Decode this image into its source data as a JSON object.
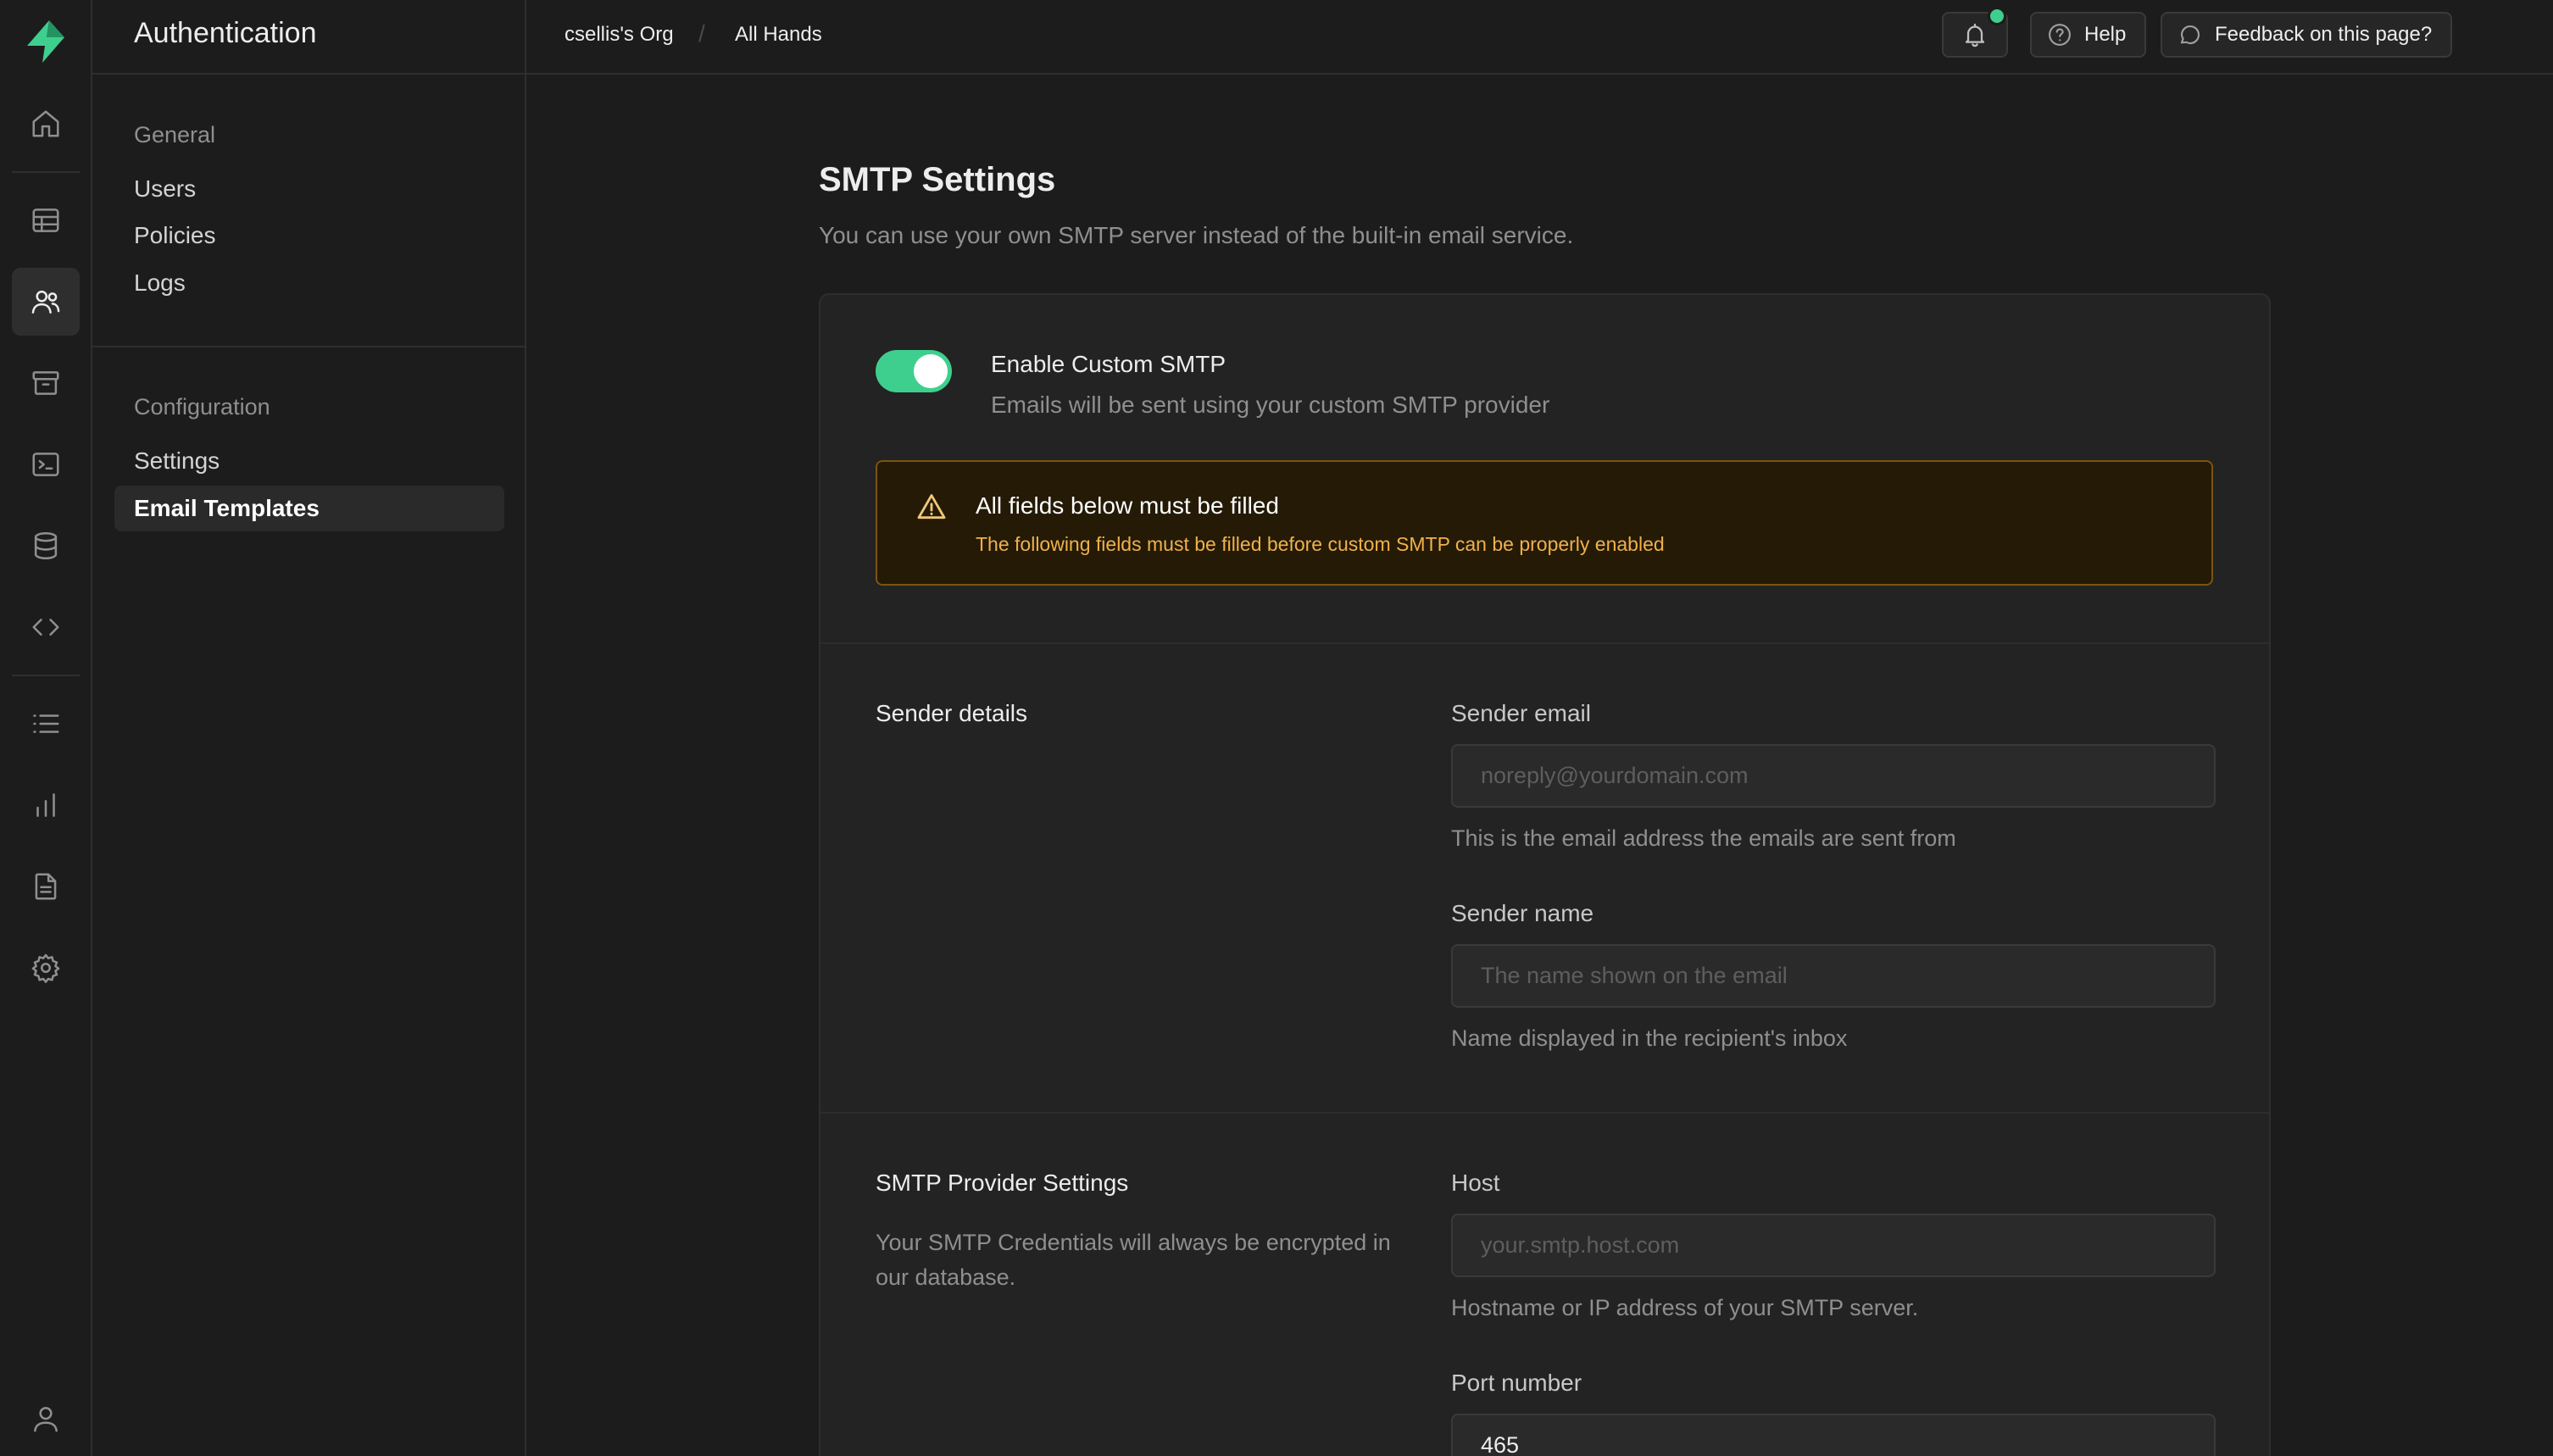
{
  "app": {
    "section_title": "Authentication",
    "accent_color": "#3ecf8e"
  },
  "rail": {
    "items": [
      {
        "icon": "home-icon"
      },
      {
        "icon": "table-editor-icon"
      },
      {
        "icon": "users-icon",
        "active": true
      },
      {
        "icon": "storage-icon"
      },
      {
        "icon": "sql-editor-icon"
      },
      {
        "icon": "database-icon"
      },
      {
        "icon": "api-code-icon"
      },
      {
        "icon": "logs-list-icon"
      },
      {
        "icon": "reports-chart-icon"
      },
      {
        "icon": "docs-icon"
      },
      {
        "icon": "settings-gear-icon"
      },
      {
        "icon": "account-user-icon"
      }
    ]
  },
  "sidebar": {
    "groups": [
      {
        "title": "General",
        "items": [
          "Users",
          "Policies",
          "Logs"
        ]
      },
      {
        "title": "Configuration",
        "items": [
          "Settings",
          "Email Templates"
        ],
        "active": "Email Templates"
      }
    ]
  },
  "topbar": {
    "org": "csellis's Org",
    "project": "All Hands",
    "help_label": "Help",
    "feedback_label": "Feedback on this page?"
  },
  "page": {
    "title": "SMTP Settings",
    "subtitle": "You can use your own SMTP server instead of the built-in email service."
  },
  "smtp": {
    "toggle_label": "Enable Custom SMTP",
    "toggle_desc": "Emails will be sent using your custom SMTP provider",
    "toggle_on": true,
    "alert_title": "All fields below must be filled",
    "alert_desc": "The following fields must be filled before custom SMTP can be properly enabled"
  },
  "sender": {
    "title": "Sender details",
    "email_label": "Sender email",
    "email_placeholder": "noreply@yourdomain.com",
    "email_help": "This is the email address the emails are sent from",
    "name_label": "Sender name",
    "name_placeholder": "The name shown on the email",
    "name_help": "Name displayed in the recipient's inbox"
  },
  "provider": {
    "title": "SMTP Provider Settings",
    "desc": "Your SMTP Credentials will always be encrypted in our database.",
    "host_label": "Host",
    "host_placeholder": "your.smtp.host.com",
    "host_help": "Hostname or IP address of your SMTP server.",
    "port_label": "Port number",
    "port_value": "465"
  }
}
